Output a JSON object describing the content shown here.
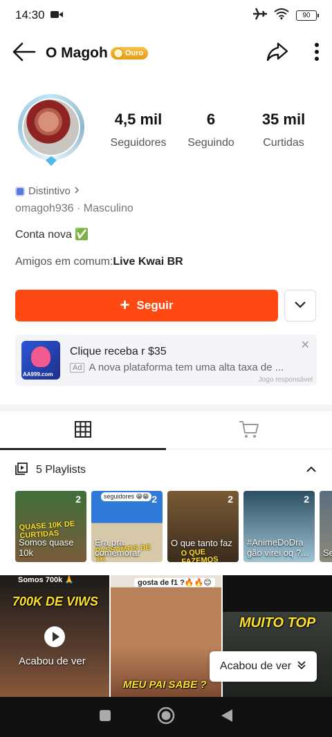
{
  "status": {
    "time": "14:30",
    "battery": "90"
  },
  "header": {
    "name": "O Magoh",
    "badge": "Ouro"
  },
  "stats": [
    {
      "num": "4,5 mil",
      "label": "Seguidores"
    },
    {
      "num": "6",
      "label": "Seguindo"
    },
    {
      "num": "35 mil",
      "label": "Curtidas"
    }
  ],
  "profile": {
    "distintivo": "Distintivo",
    "meta": "omagoh936 · Masculino",
    "bio": "Conta nova ✅",
    "friends_label": "Amigos em comum:",
    "friends_name": "Live Kwai BR",
    "follow_label": "Seguir"
  },
  "ad": {
    "title": "Clique receba r $35",
    "tag": "Ad",
    "text": "A nova plataforma tem uma alta taxa de ...",
    "responsible": "Jogo responsável",
    "thumb_text": "AA999.com"
  },
  "playlists": {
    "header": "5 Playlists",
    "items": [
      {
        "count": "2",
        "title": "Somos quase 10k",
        "overlay": "QUASE 10K DE CURTIDAS"
      },
      {
        "count": "2",
        "title": "Era pra comemorar",
        "overlay": "PASSAMOS DE 1K",
        "top": "seguidores 😁😁"
      },
      {
        "count": "2",
        "title": "O que tanto faz",
        "overlay": "O QUE FAZEMOS"
      },
      {
        "count": "2",
        "title": "#AnimeDoDra gão virei oq ?...",
        "overlay": ""
      },
      {
        "count": "",
        "title": "Se se",
        "overlay": ""
      }
    ]
  },
  "videos": [
    {
      "caption": "Somos 700k 🙏",
      "overlay": "700K DE VIWS",
      "watched": "Acabou de ver"
    },
    {
      "caption": "gosta de f1 ?🔥🔥😊",
      "overlay": "MEU PAI SABE ?"
    },
    {
      "caption": "",
      "overlay": "MUITO TOP"
    }
  ],
  "watched_pill": "Acabou de ver"
}
